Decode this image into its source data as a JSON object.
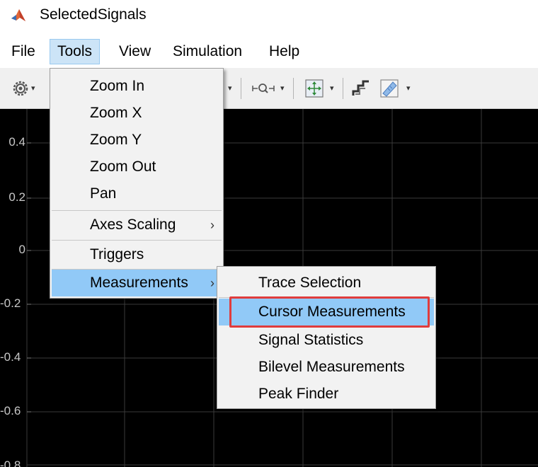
{
  "window": {
    "title": "SelectedSignals"
  },
  "menubar": {
    "items": [
      {
        "label": "File"
      },
      {
        "label": "Tools"
      },
      {
        "label": "View"
      },
      {
        "label": "Simulation"
      },
      {
        "label": "Help"
      }
    ],
    "active": "Tools"
  },
  "toolbar": {
    "icons": [
      "gear-icon",
      "zoom-dropdown-icon",
      "fit-to-view-icon",
      "step-icon",
      "measurement-ruler-icon"
    ]
  },
  "plot": {
    "background": "#000000",
    "y_tick_labels": [
      "0.4",
      "0.2",
      "0",
      "-0.2",
      "-0.4",
      "-0.6",
      "-0.8"
    ]
  },
  "tools_menu": {
    "items": [
      {
        "label": "Zoom In"
      },
      {
        "label": "Zoom X"
      },
      {
        "label": "Zoom Y"
      },
      {
        "label": "Zoom Out"
      },
      {
        "label": "Pan"
      },
      {
        "label": "Axes Scaling",
        "submenu": true
      },
      {
        "label": "Triggers"
      },
      {
        "label": "Measurements",
        "submenu": true,
        "highlighted": true
      }
    ]
  },
  "measurements_submenu": {
    "items": [
      {
        "label": "Trace Selection"
      },
      {
        "label": "Cursor Measurements",
        "highlighted": true,
        "outlined": true
      },
      {
        "label": "Signal Statistics"
      },
      {
        "label": "Bilevel Measurements"
      },
      {
        "label": "Peak Finder"
      }
    ]
  },
  "colors": {
    "menu_highlight": "#91c9f7",
    "outline_red": "#e03c3c",
    "plot_grid": "#3a3a3a",
    "tick_label": "#c8c8c8"
  }
}
